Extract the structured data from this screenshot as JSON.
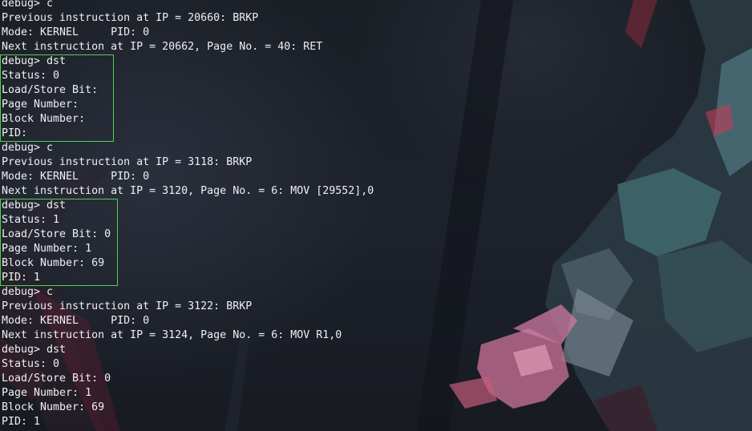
{
  "terminal": {
    "lines": [
      "debug> c",
      "Previous instruction at IP = 20660: BRKP",
      "Mode: KERNEL     PID: 0",
      "Next instruction at IP = 20662, Page No. = 40: RET",
      "debug> dst",
      "Status: 0",
      "Load/Store Bit:",
      "Page Number:",
      "Block Number:",
      "PID:",
      "debug> c",
      "Previous instruction at IP = 3118: BRKP",
      "Mode: KERNEL     PID: 0",
      "Next instruction at IP = 3120, Page No. = 6: MOV [29552],0",
      "debug> dst",
      "Status: 1",
      "Load/Store Bit: 0",
      "Page Number: 1",
      "Block Number: 69",
      "PID: 1",
      "debug> c",
      "Previous instruction at IP = 3122: BRKP",
      "Mode: KERNEL     PID: 0",
      "Next instruction at IP = 3124, Page No. = 6: MOV R1,0",
      "debug> dst",
      "Status: 0",
      "Load/Store Bit: 0",
      "Page Number: 1",
      "Block Number: 69",
      "PID: 1"
    ]
  },
  "highlight_color": "#4fd24f",
  "text_color": "#f0f0f0",
  "background_color": "#1b1f27"
}
